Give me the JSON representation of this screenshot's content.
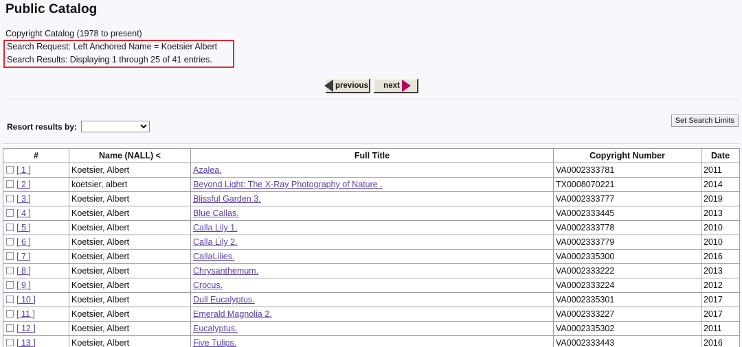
{
  "page": {
    "title": "Public Catalog",
    "catalog_line": "Copyright Catalog (1978 to present)",
    "search_request": "Search Request: Left Anchored Name = Koetsier Albert",
    "search_results": "Search Results: Displaying 1 through 25 of 41 entries.",
    "annotation_border_color": "#e8272a"
  },
  "nav": {
    "previous_label": "previous",
    "next_label": "next",
    "previous_icon": "triangle-left-icon",
    "next_icon": "triangle-right-icon",
    "previous_arrow_color": "#3a3a3a",
    "next_arrow_color": "#b5005e"
  },
  "controls": {
    "resort_label": "Resort results by:",
    "resort_value": "",
    "resort_options": [
      ""
    ],
    "set_limits_label": "Set Search Limits"
  },
  "table": {
    "headers": [
      "#",
      "Name (NALL) <",
      "Full Title",
      "Copyright Number",
      "Date"
    ],
    "rows": [
      {
        "idx": "[ 1 ]",
        "name": "Koetsier, Albert",
        "title": "Azalea.",
        "copyright": "VA0002333781",
        "date": "2011"
      },
      {
        "idx": "[ 2 ]",
        "name": "koetsier, albert",
        "title": "Beyond Light: The X-Ray Photography of Nature .",
        "copyright": "TX0008070221",
        "date": "2014"
      },
      {
        "idx": "[ 3 ]",
        "name": "Koetsier, Albert",
        "title": "Blissful Garden 3.",
        "copyright": "VA0002333777",
        "date": "2019"
      },
      {
        "idx": "[ 4 ]",
        "name": "Koetsier, Albert",
        "title": "Blue Callas.",
        "copyright": "VA0002333445",
        "date": "2013"
      },
      {
        "idx": "[ 5 ]",
        "name": "Koetsier, Albert",
        "title": "Calla Lily 1.",
        "copyright": "VA0002333778",
        "date": "2010"
      },
      {
        "idx": "[ 6 ]",
        "name": "Koetsier, Albert",
        "title": "Calla Lily 2.",
        "copyright": "VA0002333779",
        "date": "2010"
      },
      {
        "idx": "[ 7 ]",
        "name": "Koetsier, Albert",
        "title": "CallaLilies.",
        "copyright": "VA0002335300",
        "date": "2016"
      },
      {
        "idx": "[ 8 ]",
        "name": "Koetsier, Albert",
        "title": "Chrysanthemum.",
        "copyright": "VA0002333222",
        "date": "2013"
      },
      {
        "idx": "[ 9 ]",
        "name": "Koetsier, Albert",
        "title": "Crocus.",
        "copyright": "VA0002333224",
        "date": "2012"
      },
      {
        "idx": "[ 10 ]",
        "name": "Koetsier, Albert",
        "title": "Dull Eucalyptus.",
        "copyright": "VA0002335301",
        "date": "2017"
      },
      {
        "idx": "[ 11 ]",
        "name": "Koetsier, Albert",
        "title": "Emerald Magnolia 2.",
        "copyright": "VA0002333227",
        "date": "2017"
      },
      {
        "idx": "[ 12 ]",
        "name": "Koetsier, Albert",
        "title": "Eucalyptus.",
        "copyright": "VA0002335302",
        "date": "2011"
      },
      {
        "idx": "[ 13 ]",
        "name": "Koetsier, Albert",
        "title": "Five Tulips.",
        "copyright": "VA0002333443",
        "date": "2016"
      }
    ]
  }
}
